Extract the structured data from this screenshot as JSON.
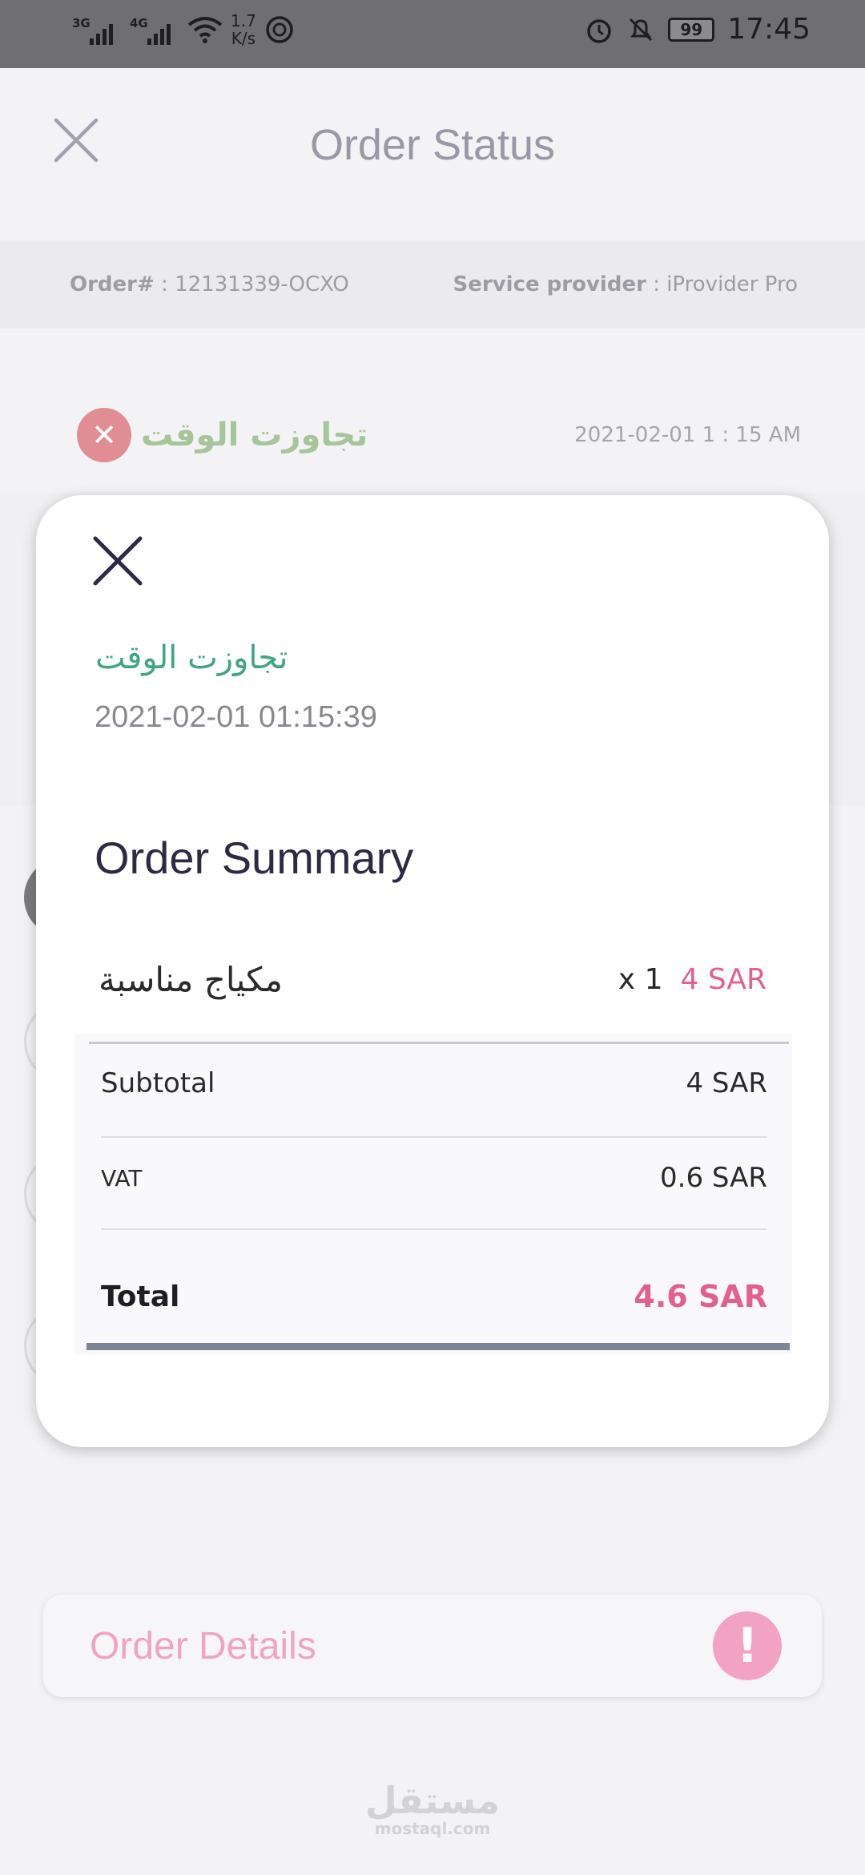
{
  "status_bar": {
    "network1": "3G",
    "network2": "4G",
    "speed_value": "1.7",
    "speed_unit": "K/s",
    "battery": "99",
    "time": "17:45"
  },
  "header": {
    "title": "Order Status"
  },
  "order_info": {
    "order_label": "Order#",
    "order_value": ": 12131339-OCXO",
    "provider_label": "Service provider",
    "provider_value": ": iProvider Pro"
  },
  "status_entry": {
    "status_text": "تجاوزت الوقت",
    "timestamp": "2021-02-01   1 : 15 AM"
  },
  "modal": {
    "status_text": "تجاوزت الوقت",
    "timestamp": "2021-02-01 01:15:39",
    "summary_title": "Order Summary",
    "item": {
      "name": "مكياج مناسبة",
      "quantity": "x 1",
      "price": "4 SAR"
    },
    "subtotal_label": "Subtotal",
    "subtotal_value": "4 SAR",
    "vat_label": "VAT",
    "vat_value": "0.6 SAR",
    "total_label": "Total",
    "total_value": "4.6  SAR"
  },
  "order_details": {
    "label": "Order Details"
  },
  "watermark": {
    "arabic": "مستقل",
    "latin": "mostaql.com"
  },
  "colors": {
    "accent_pink": "#e2608f",
    "status_green": "#3da77f",
    "title_dark": "#2d2a45"
  }
}
